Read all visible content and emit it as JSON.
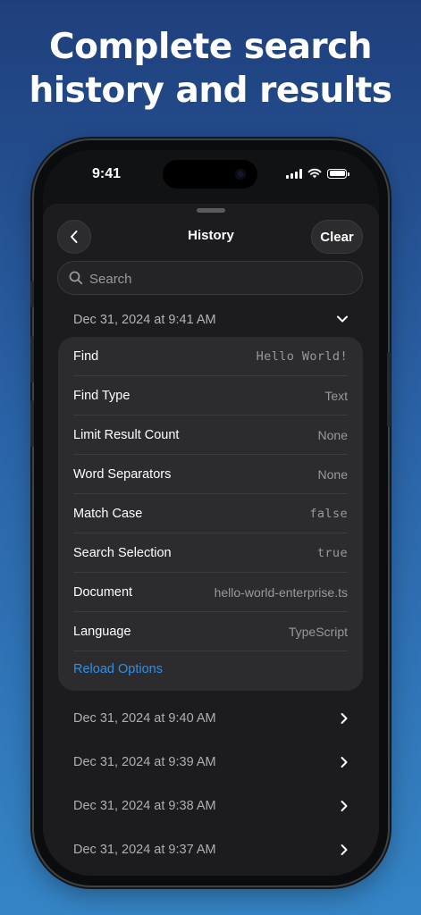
{
  "headline": {
    "line1": "Complete search",
    "line2": "history and results"
  },
  "status_bar": {
    "time": "9:41"
  },
  "nav": {
    "title": "History",
    "clear_label": "Clear"
  },
  "search": {
    "placeholder": "Search"
  },
  "expanded_entry": {
    "date": "Dec 31, 2024 at 9:41 AM",
    "rows": [
      {
        "label": "Find",
        "value": "Hello World!"
      },
      {
        "label": "Find Type",
        "value": "Text"
      },
      {
        "label": "Limit Result Count",
        "value": "None"
      },
      {
        "label": "Word Separators",
        "value": "None"
      },
      {
        "label": "Match Case",
        "value": "false"
      },
      {
        "label": "Search Selection",
        "value": "true"
      },
      {
        "label": "Document",
        "value": "hello-world-enterprise.ts"
      },
      {
        "label": "Language",
        "value": "TypeScript"
      }
    ],
    "reload_label": "Reload Options"
  },
  "history": [
    {
      "date": "Dec 31, 2024 at 9:40 AM"
    },
    {
      "date": "Dec 31, 2024 at 9:39 AM"
    },
    {
      "date": "Dec 31, 2024 at 9:38 AM"
    },
    {
      "date": "Dec 31, 2024 at 9:37 AM"
    }
  ],
  "colors": {
    "accent": "#2f8fe8",
    "sheet": "#1c1c1e",
    "card": "#2c2c2e"
  }
}
